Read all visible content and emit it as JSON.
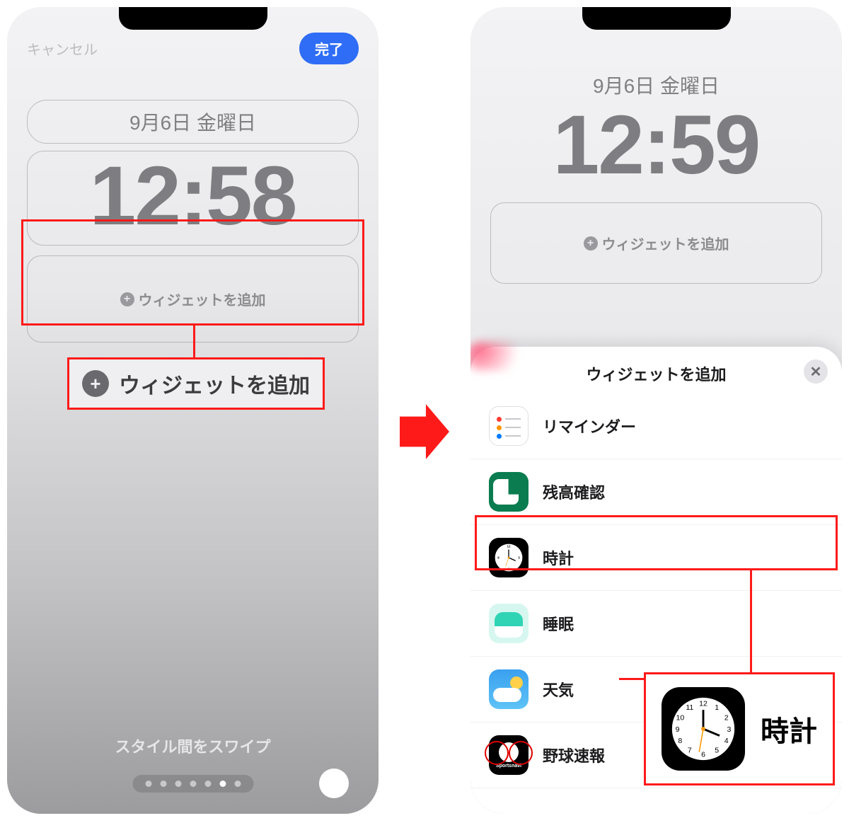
{
  "left": {
    "cancel": "キャンセル",
    "done": "完了",
    "date": "9月6日 金曜日",
    "time": "12:58",
    "addWidget": "ウィジェットを追加",
    "calloutAdd": "ウィジェットを追加",
    "swipe": "スタイル間をスワイプ"
  },
  "right": {
    "date": "9月6日 金曜日",
    "time": "12:59",
    "addWidget": "ウィジェットを追加",
    "sheetTitle": "ウィジェットを追加",
    "items": [
      {
        "label": "リマインダー"
      },
      {
        "label": "残高確認"
      },
      {
        "label": "時計"
      },
      {
        "label": "睡眠"
      },
      {
        "label": "天気"
      },
      {
        "label": "野球速報"
      }
    ],
    "calloutClock": "時計",
    "sportsIconText": "Sportsnavi"
  }
}
